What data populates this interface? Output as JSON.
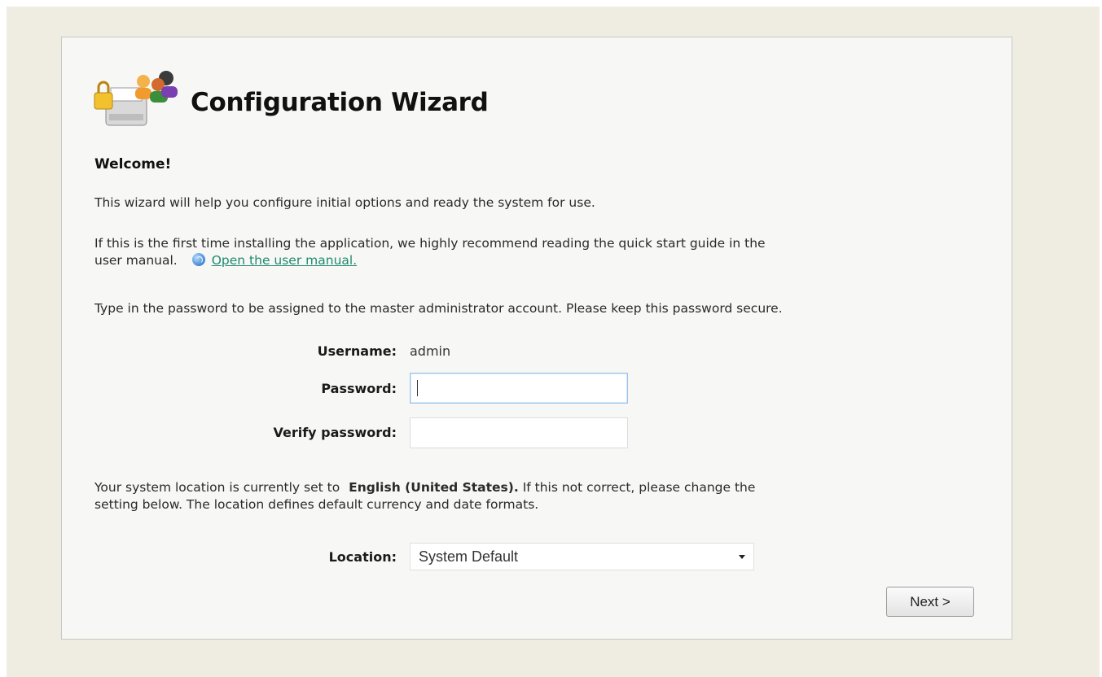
{
  "wizard": {
    "title": "Configuration Wizard",
    "welcome_heading": "Welcome!",
    "intro_text": "This wizard will help you configure initial options and ready the system for use.",
    "manual_text_line1": "If this is the first time installing the application, we highly recommend reading the quick start guide in the",
    "manual_text_line2": "user manual.",
    "manual_link": "Open the user manual.",
    "password_instruction": "Type in the password to be assigned to the master administrator account. Please keep this password secure.",
    "username_label": "Username:",
    "username_value": "admin",
    "password_label": "Password:",
    "password_value": "",
    "verify_label": "Verify password:",
    "verify_value": "",
    "location_text_prefix": "Your system location is currently set to",
    "location_current": "English (United States).",
    "location_text_suffix": "If this not correct, please change the",
    "location_text_line2": "setting below. The location defines default currency and date formats.",
    "location_label": "Location:",
    "location_selected": "System Default",
    "next_button": "Next >"
  },
  "icons": {
    "header_icon": "admin-users-printer-lock-icon",
    "help_icon": "help-icon",
    "dropdown_icon": "chevron-down-icon"
  },
  "colors": {
    "page_background": "#efede1",
    "panel_background": "#f7f7f5",
    "link": "#1f8a6f"
  }
}
